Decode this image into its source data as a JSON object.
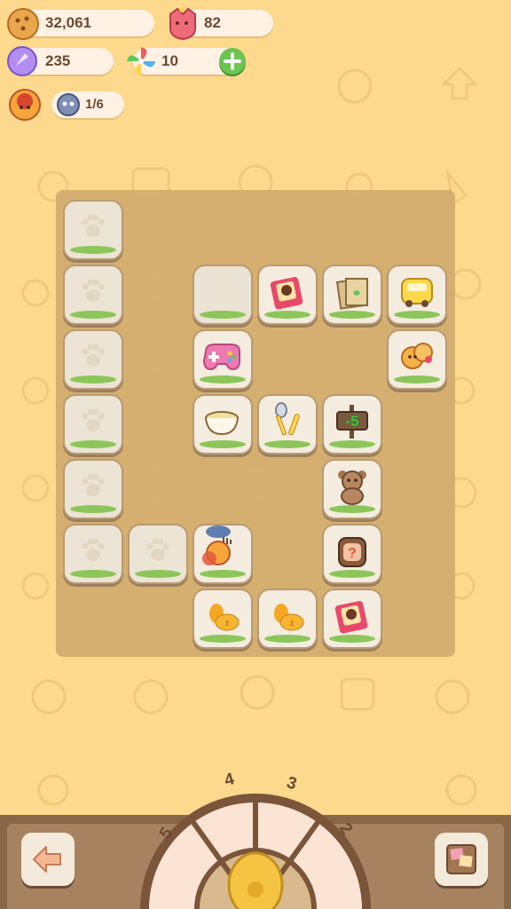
{
  "resources": {
    "coins": "32,061",
    "hearts": "82",
    "gems": "235",
    "flowers": "10",
    "quest_progress": "1/6"
  },
  "icons": {
    "coins": "cookie-coin-icon",
    "hearts": "pink-heart-face-icon",
    "gems": "crystal-gem-icon",
    "flowers": "pinwheel-flower-icon",
    "add": "plus-icon",
    "character": "chick-avatar-icon",
    "quest": "robot-helper-icon"
  },
  "board": {
    "sign_label": "-5"
  },
  "dial": {
    "labels": [
      "5",
      "4",
      "3",
      "2"
    ]
  },
  "colors": {
    "background": "#fcd98d",
    "board": "#d3ad6e",
    "bottom_bar": "#8a6749"
  }
}
